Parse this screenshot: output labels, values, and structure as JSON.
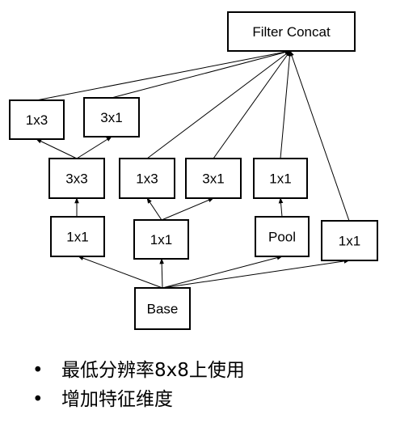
{
  "diagram": {
    "nodes": [
      {
        "id": "filter-concat",
        "label": "Filter Concat"
      },
      {
        "id": "l-1x3",
        "label": "1x3"
      },
      {
        "id": "l-3x1",
        "label": "3x1"
      },
      {
        "id": "l-3x3",
        "label": "3x3"
      },
      {
        "id": "m-1x3",
        "label": "1x3"
      },
      {
        "id": "m-3x1",
        "label": "3x1"
      },
      {
        "id": "r-1x1-top",
        "label": "1x1"
      },
      {
        "id": "l-1x1",
        "label": "1x1"
      },
      {
        "id": "m-1x1",
        "label": "1x1"
      },
      {
        "id": "pool",
        "label": "Pool"
      },
      {
        "id": "far-1x1",
        "label": "1x1"
      },
      {
        "id": "base",
        "label": "Base"
      }
    ],
    "edges": [
      {
        "from": "base",
        "to": "l-1x1"
      },
      {
        "from": "base",
        "to": "m-1x1"
      },
      {
        "from": "base",
        "to": "pool"
      },
      {
        "from": "base",
        "to": "far-1x1"
      },
      {
        "from": "l-1x1",
        "to": "l-3x3"
      },
      {
        "from": "l-3x3",
        "to": "l-1x3"
      },
      {
        "from": "l-3x3",
        "to": "l-3x1"
      },
      {
        "from": "m-1x1",
        "to": "m-1x3"
      },
      {
        "from": "m-1x1",
        "to": "m-3x1"
      },
      {
        "from": "pool",
        "to": "r-1x1-top"
      },
      {
        "from": "l-1x3",
        "to": "filter-concat"
      },
      {
        "from": "l-3x1",
        "to": "filter-concat"
      },
      {
        "from": "m-1x3",
        "to": "filter-concat"
      },
      {
        "from": "m-3x1",
        "to": "filter-concat"
      },
      {
        "from": "r-1x1-top",
        "to": "filter-concat"
      },
      {
        "from": "far-1x1",
        "to": "filter-concat"
      }
    ]
  },
  "bullets": [
    {
      "symbol": "•",
      "text": "最低分辨率8x8上使用"
    },
    {
      "symbol": "•",
      "text": "增加特征维度"
    }
  ]
}
